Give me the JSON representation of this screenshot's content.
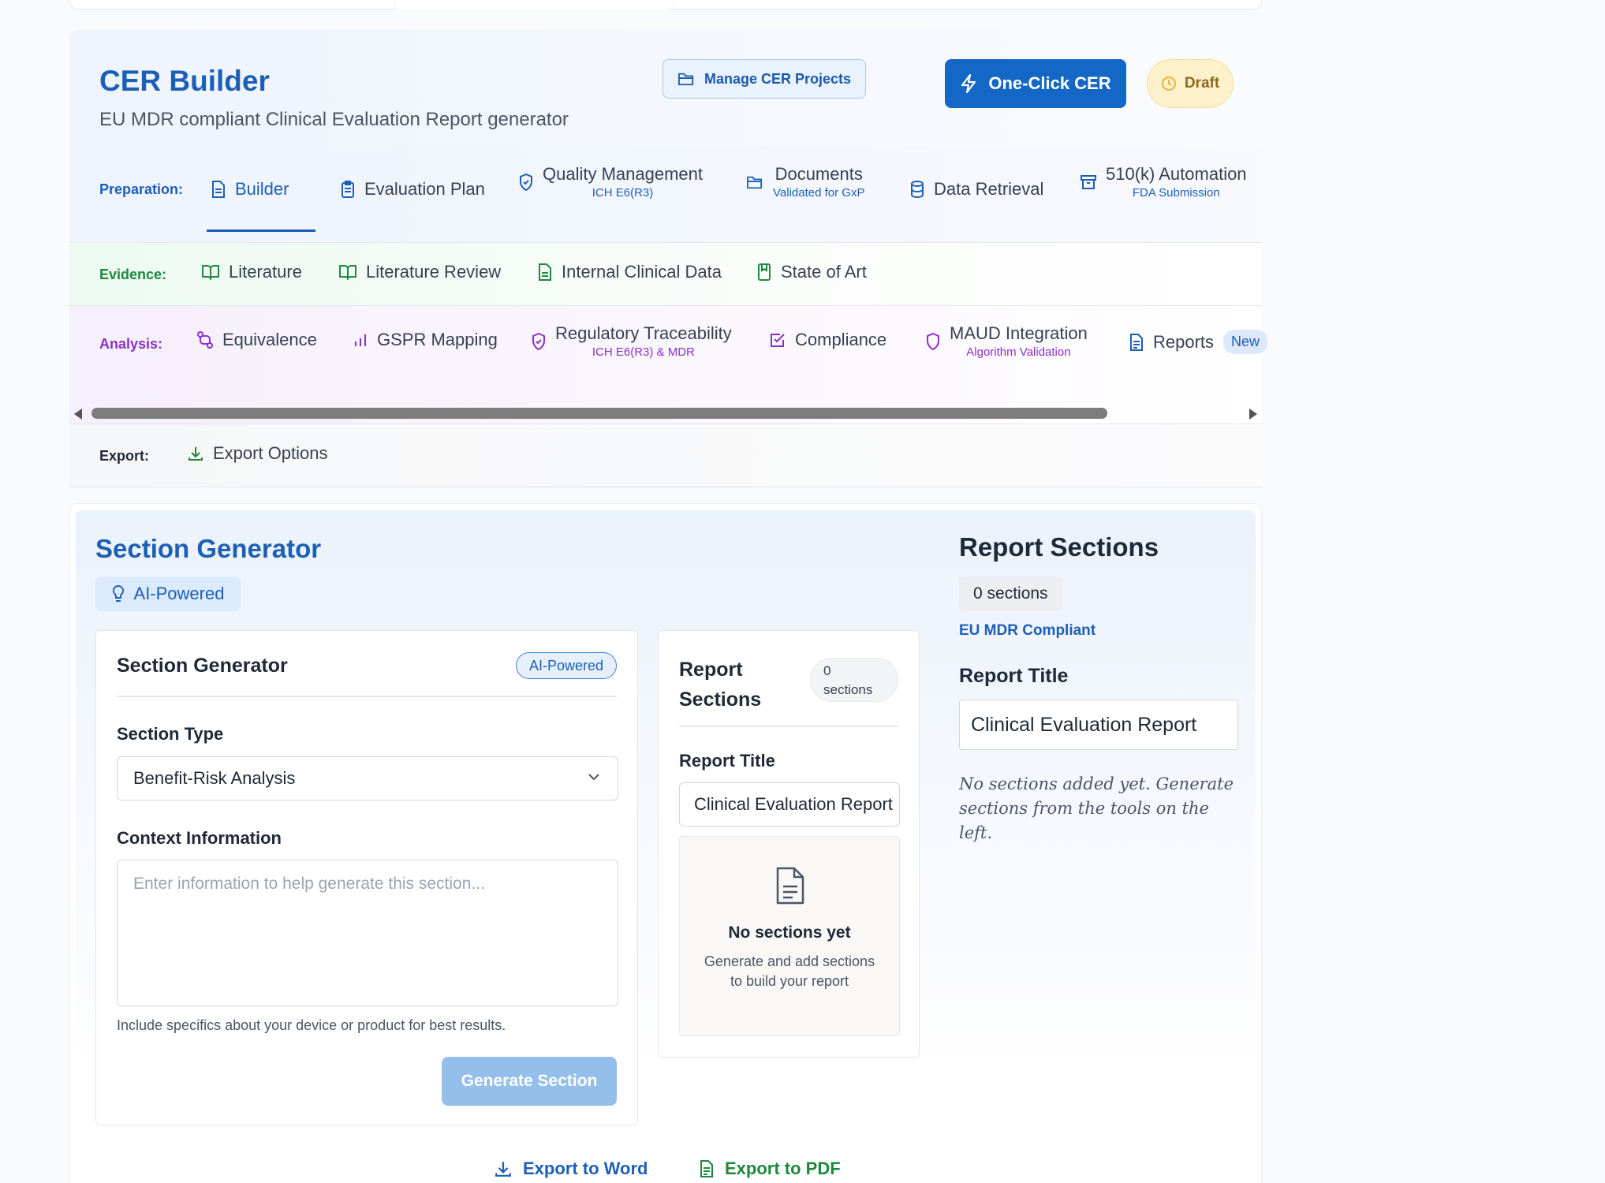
{
  "header": {
    "title": "CER Builder",
    "subtitle": "EU MDR compliant Clinical Evaluation Report generator",
    "manage_label": "Manage CER Projects",
    "oneclick_label": "One-Click CER",
    "status_label": "Draft"
  },
  "nav": {
    "preparation": {
      "label": "Preparation:",
      "items": [
        {
          "label": "Builder",
          "icon": "document-icon"
        },
        {
          "label": "Evaluation Plan",
          "icon": "clipboard-icon"
        },
        {
          "label": "Quality Management",
          "sub": "ICH E6(R3)",
          "icon": "shield-icon"
        },
        {
          "label": "Documents",
          "sub": "Validated for GxP",
          "icon": "folder-icon"
        },
        {
          "label": "Data Retrieval",
          "icon": "database-icon"
        },
        {
          "label": "510(k) Automation",
          "sub": "FDA Submission",
          "icon": "archive-icon"
        }
      ]
    },
    "evidence": {
      "label": "Evidence:",
      "items": [
        {
          "label": "Literature",
          "icon": "book-icon"
        },
        {
          "label": "Literature Review",
          "icon": "book-icon"
        },
        {
          "label": "Internal Clinical Data",
          "icon": "file-icon"
        },
        {
          "label": "State of Art",
          "icon": "bookmark-book-icon"
        }
      ]
    },
    "analysis": {
      "label": "Analysis:",
      "items": [
        {
          "label": "Equivalence",
          "icon": "git-compare-icon"
        },
        {
          "label": "GSPR Mapping",
          "icon": "bar-chart-icon"
        },
        {
          "label": "Regulatory Traceability",
          "sub": "ICH E6(R3) & MDR",
          "icon": "shield-icon"
        },
        {
          "label": "Compliance",
          "icon": "check-square-icon"
        },
        {
          "label": "MAUD Integration",
          "sub": "Algorithm Validation",
          "icon": "shield-icon"
        },
        {
          "label": "Reports",
          "badge": "New",
          "icon": "file-text-icon"
        }
      ]
    },
    "export": {
      "label": "Export:",
      "items": [
        {
          "label": "Export Options",
          "icon": "download-icon"
        }
      ]
    }
  },
  "section_generator": {
    "title": "Section Generator",
    "ai_badge": "AI-Powered",
    "card": {
      "title": "Section Generator",
      "badge": "AI-Powered",
      "section_type_label": "Section Type",
      "section_type_value": "Benefit-Risk Analysis",
      "context_label": "Context Information",
      "context_placeholder": "Enter information to help generate this section...",
      "hint": "Include specifics about your device or product for best results.",
      "generate_label": "Generate Section"
    }
  },
  "report_card": {
    "title": "Report Sections",
    "count_number": "0",
    "count_word": "sections",
    "report_title_label": "Report Title",
    "report_title_value": "Clinical Evaluation Report",
    "empty_title": "No sections yet",
    "empty_desc": "Generate and add sections to build your report"
  },
  "side_panel": {
    "title": "Report Sections",
    "count": "0 sections",
    "compliance": "EU MDR Compliant",
    "report_title_label": "Report Title",
    "report_title_value": "Clinical Evaluation Report",
    "empty_message": "No sections added yet. Generate sections from the tools on the left."
  },
  "exports": {
    "word_label": "Export to Word",
    "pdf_label": "Export to PDF"
  },
  "colors": {
    "primary": "#1467c4",
    "preparation": "#1d5fb6",
    "evidence": "#1b8a3e",
    "analysis": "#8b2fc9",
    "draft_bg": "#fdf1cc"
  }
}
